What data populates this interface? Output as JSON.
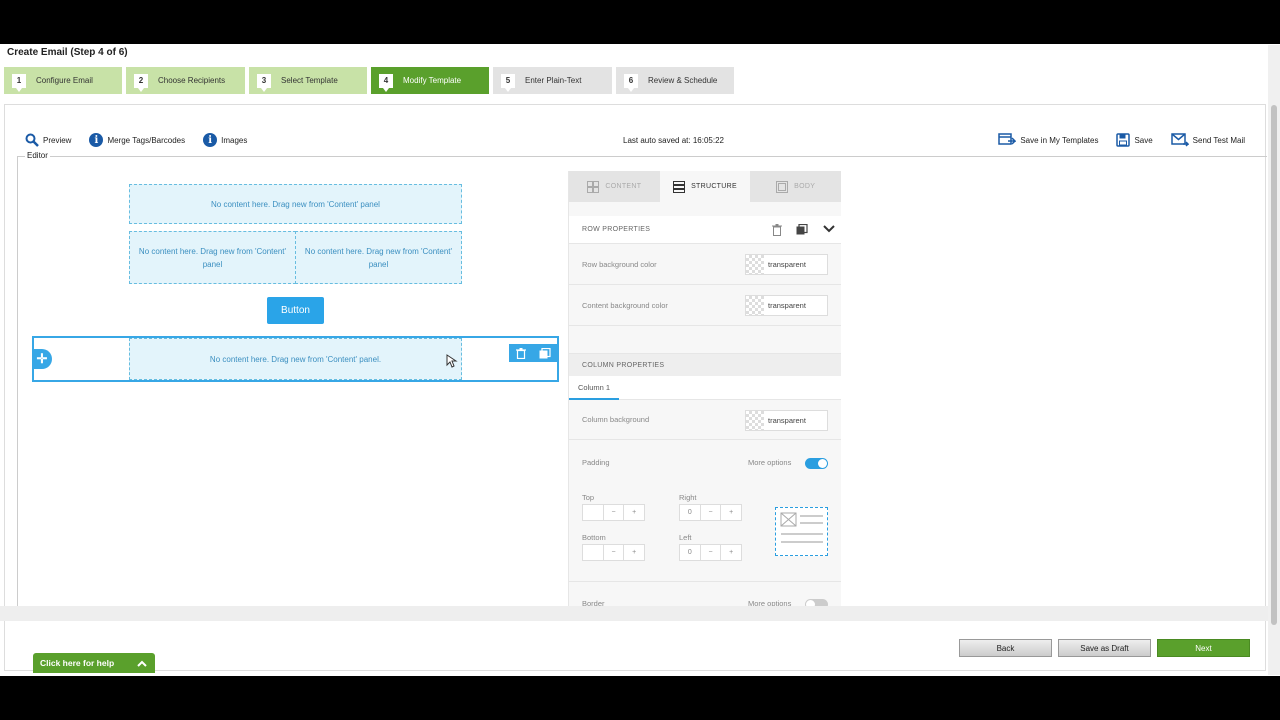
{
  "page_title": "Create Email (Step 4 of 6)",
  "steps": [
    {
      "num": "1",
      "label": "Configure Email",
      "state": "done"
    },
    {
      "num": "2",
      "label": "Choose Recipients",
      "state": "done"
    },
    {
      "num": "3",
      "label": "Select Template",
      "state": "done"
    },
    {
      "num": "4",
      "label": "Modify Template",
      "state": "active"
    },
    {
      "num": "5",
      "label": "Enter Plain-Text",
      "state": "todo"
    },
    {
      "num": "6",
      "label": "Review & Schedule",
      "state": "todo"
    }
  ],
  "toolbar": {
    "preview": "Preview",
    "merge_tags": "Merge Tags/Barcodes",
    "images": "Images",
    "autosave": "Last auto saved at: 16:05:22",
    "save_my_templates": "Save in My Templates",
    "save": "Save",
    "send_test": "Send Test Mail"
  },
  "editor_label": "Editor",
  "canvas": {
    "drop_full": "No content here. Drag new from 'Content' panel",
    "drop_left": "No content here. Drag new from 'Content' panel",
    "drop_right": "No content here. Drag new from 'Content' panel",
    "button_label": "Button",
    "drop_selected": "No content here. Drag new from 'Content' panel."
  },
  "side_tabs": {
    "content": "CONTENT",
    "structure": "STRUCTURE",
    "body": "BODY"
  },
  "row_props": {
    "title": "ROW PROPERTIES",
    "row_bg_label": "Row background color",
    "row_bg_value": "transparent",
    "content_bg_label": "Content background color",
    "content_bg_value": "transparent"
  },
  "col_props": {
    "title": "COLUMN PROPERTIES",
    "tab": "Column 1",
    "col_bg_label": "Column background",
    "col_bg_value": "transparent",
    "padding_label": "Padding",
    "more_options": "More options",
    "top": "Top",
    "right": "Right",
    "bottom": "Bottom",
    "left": "Left",
    "top_value": "",
    "right_value": "0",
    "bottom_value": "",
    "left_value": "0",
    "border_label": "Border",
    "border_more_options": "More options"
  },
  "footer": {
    "back": "Back",
    "save_draft": "Save as Draft",
    "next": "Next",
    "help": "Click here for help"
  },
  "colors": {
    "step_done": "#c8e2a7",
    "step_active": "#5aa02c",
    "accent_blue": "#2aa4e8"
  }
}
